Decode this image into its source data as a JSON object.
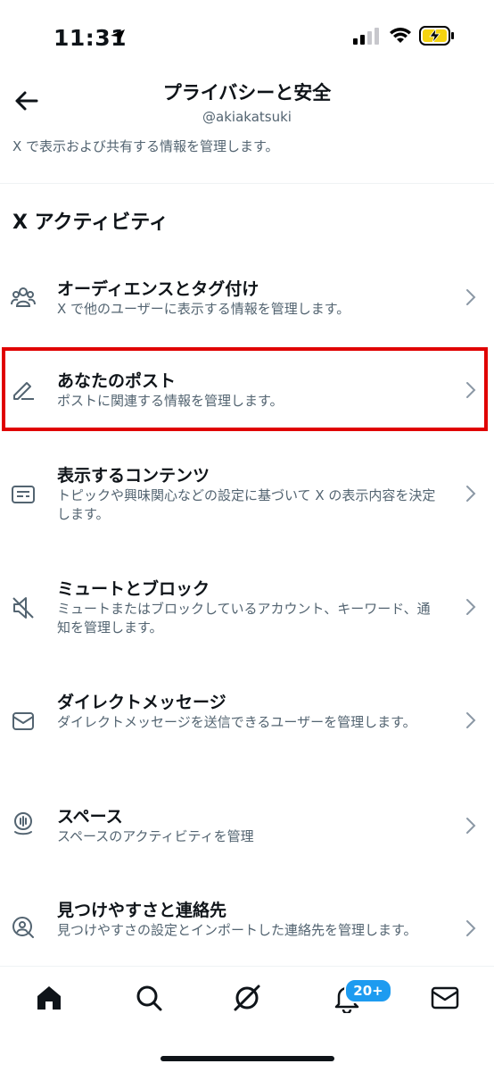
{
  "status_bar": {
    "time": "11:31"
  },
  "header": {
    "title": "プライバシーと安全",
    "handle": "@akiakatsuki",
    "description": "X で表示および共有する情報を管理します。"
  },
  "section": {
    "title": "X アクティビティ"
  },
  "items": [
    {
      "title": "オーディエンスとタグ付け",
      "desc": "X で他のユーザーに表示する情報を管理します。",
      "icon": "people-icon"
    },
    {
      "title": "あなたのポスト",
      "desc": "ポストに関連する情報を管理します。",
      "icon": "pencil-icon"
    },
    {
      "title": "表示するコンテンツ",
      "desc": "トピックや興味関心などの設定に基づいて X の表示内容を決定します。",
      "icon": "content-card-icon"
    },
    {
      "title": "ミュートとブロック",
      "desc": "ミュートまたはブロックしているアカウント、キーワード、通知を管理します。",
      "icon": "mute-icon"
    },
    {
      "title": "ダイレクトメッセージ",
      "desc": "ダイレクトメッセージを送信できるユーザーを管理します。",
      "icon": "envelope-icon"
    },
    {
      "title": "スペース",
      "desc": "スペースのアクティビティを管理",
      "icon": "spaces-icon"
    },
    {
      "title": "見つけやすさと連絡先",
      "desc": "見つけやすさの設定とインポートした連絡先を管理します。",
      "icon": "person-search-icon"
    }
  ],
  "tabbar": {
    "notifications_badge": "20+"
  },
  "colors": {
    "accent": "#1d9bf0",
    "highlight": "#e00000",
    "secondary_text": "#536471"
  }
}
